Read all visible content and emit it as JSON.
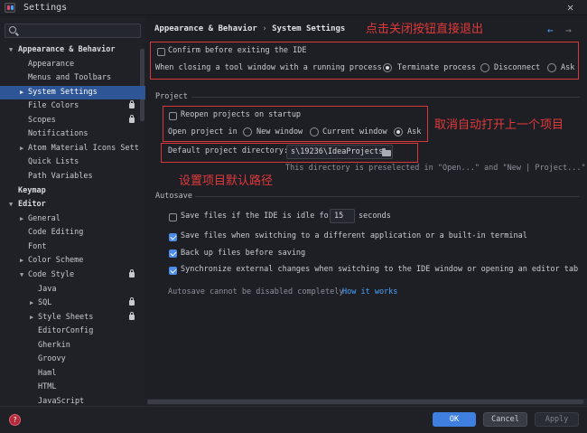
{
  "window": {
    "title": "Settings"
  },
  "search": {
    "placeholder": ""
  },
  "sidebar": {
    "items": [
      {
        "label": "Appearance & Behavior"
      },
      {
        "label": "Appearance"
      },
      {
        "label": "Menus and Toolbars"
      },
      {
        "label": "System Settings"
      },
      {
        "label": "File Colors"
      },
      {
        "label": "Scopes"
      },
      {
        "label": "Notifications"
      },
      {
        "label": "Atom Material Icons Sett"
      },
      {
        "label": "Quick Lists"
      },
      {
        "label": "Path Variables"
      },
      {
        "label": "Keymap"
      },
      {
        "label": "Editor"
      },
      {
        "label": "General"
      },
      {
        "label": "Code Editing"
      },
      {
        "label": "Font"
      },
      {
        "label": "Color Scheme"
      },
      {
        "label": "Code Style"
      },
      {
        "label": "Java"
      },
      {
        "label": "SQL"
      },
      {
        "label": "Style Sheets"
      },
      {
        "label": "EditorConfig"
      },
      {
        "label": "Gherkin"
      },
      {
        "label": "Groovy"
      },
      {
        "label": "Haml"
      },
      {
        "label": "HTML"
      },
      {
        "label": "JavaScript"
      }
    ]
  },
  "breadcrumb": {
    "parent": "Appearance & Behavior",
    "separator": "›",
    "current": "System Settings"
  },
  "nav": {
    "back": "←",
    "forward": "→"
  },
  "general": {
    "confirm_exit": {
      "label": "Confirm before exiting the IDE",
      "checked": false
    },
    "tool_window": {
      "label": "When closing a tool window with a running process:",
      "options": [
        "Terminate process",
        "Disconnect",
        "Ask"
      ],
      "selected": "Terminate process"
    }
  },
  "project": {
    "title": "Project",
    "reopen": {
      "label": "Reopen projects on startup",
      "checked": false
    },
    "open_in": {
      "label": "Open project in",
      "options": [
        "New window",
        "Current window",
        "Ask"
      ],
      "selected": "Ask"
    },
    "default_dir": {
      "label": "Default project directory:",
      "value": "s\\19236\\IdeaProjects",
      "hint": "This directory is preselected in \"Open...\" and \"New | Project...\" dia"
    }
  },
  "autosave": {
    "title": "Autosave",
    "idle": {
      "label_before": "Save files if the IDE is idle for",
      "value": "15",
      "label_after": "seconds",
      "checked": false
    },
    "switch_app": {
      "label": "Save files when switching to a different application or a built-in terminal",
      "checked": true
    },
    "backup": {
      "label": "Back up files before saving",
      "checked": true
    },
    "sync": {
      "label": "Synchronize external changes when switching to the IDE window or opening an editor tab",
      "checked": true
    },
    "note": "Autosave cannot be disabled completely.",
    "link": "How it works"
  },
  "annotations": {
    "exit": "点击关闭按钮直接退出",
    "reopen": "取消自动打开上一个项目",
    "path": "设置项目默认路径",
    "color": "#d9383a"
  },
  "footer": {
    "help": "?",
    "ok": "OK",
    "cancel": "Cancel",
    "apply": "Apply"
  },
  "colors": {
    "accent": "#3f7fe0",
    "selection": "#2e5596",
    "link": "#4aa3ff"
  }
}
